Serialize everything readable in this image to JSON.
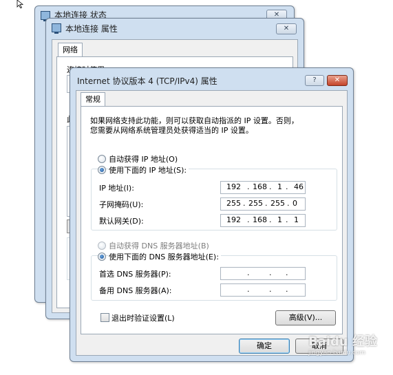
{
  "back_window": {
    "title": "本地连接 状态"
  },
  "mid_window": {
    "title": "本地连接 属性",
    "tab_label": "网络",
    "connect_using_label": "连接时使用:",
    "partial_label": "此"
  },
  "dialog": {
    "title": "Internet 协议版本 4 (TCP/IPv4) 属性",
    "help_btn": "?",
    "close_btn": "✕",
    "tab_label": "常规",
    "description_line1": "如果网络支持此功能，则可以获取自动指派的 IP 设置。否则，",
    "description_line2": "您需要从网络系统管理员处获得适当的 IP 设置。",
    "auto_ip_label": "自动获得 IP 地址(O)",
    "manual_ip_label": "使用下面的 IP 地址(S):",
    "ip_label": "IP 地址(I):",
    "subnet_label": "子网掩码(U):",
    "gateway_label": "默认网关(D):",
    "ip_address": [
      "192",
      "168",
      "1",
      "46"
    ],
    "subnet_mask": [
      "255",
      "255",
      "255",
      "0"
    ],
    "gateway": [
      "192",
      "168",
      "1",
      "1"
    ],
    "auto_dns_label": "自动获得 DNS 服务器地址(B)",
    "manual_dns_label": "使用下面的 DNS 服务器地址(E):",
    "preferred_dns_label": "首选 DNS 服务器(P):",
    "alternate_dns_label": "备用 DNS 服务器(A):",
    "validate_label": "退出时验证设置(L)",
    "advanced_btn": "高级(V)...",
    "ok_btn": "确定",
    "cancel_btn": "取消"
  },
  "watermark": "Baidu 经验",
  "watermark_url": "jingyan.baidu.com"
}
